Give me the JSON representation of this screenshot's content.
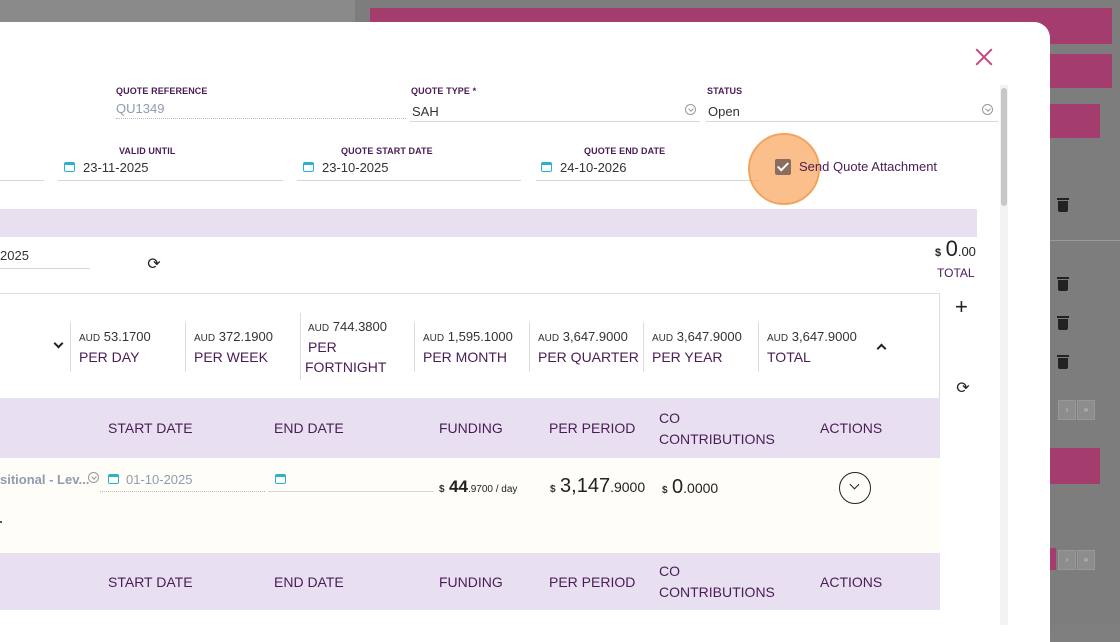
{
  "quote": {
    "reference": {
      "label": "QUOTE REFERENCE",
      "value": "QU1349"
    },
    "type": {
      "label": "QUOTE TYPE *",
      "value": "SAH"
    },
    "status": {
      "label": "STATUS",
      "value": "Open"
    },
    "valid_until": {
      "label": "VALID UNTIL",
      "value": "23-11-2025"
    },
    "start_date": {
      "label": "QUOTE START DATE",
      "value": "23-10-2025"
    },
    "end_date": {
      "label": "QUOTE END DATE",
      "value": "24-10-2026"
    },
    "send_attachment": {
      "label": "Send Quote Attachment",
      "checked": true
    },
    "date_partial": "2025",
    "total": {
      "currency": "$",
      "int": "0",
      "dec": ".00",
      "label": "TOTAL"
    }
  },
  "summary": [
    {
      "cur": "AUD",
      "int": "53",
      "dec": ".1700",
      "label": "PER DAY"
    },
    {
      "cur": "AUD",
      "int": "372",
      "dec": ".1900",
      "label": "PER WEEK"
    },
    {
      "cur": "AUD",
      "int": "744",
      "dec": ".3800",
      "label": "PER",
      "label2": "FORTNIGHT"
    },
    {
      "cur": "AUD",
      "int": "1,595",
      "dec": ".1000",
      "label": "PER MONTH"
    },
    {
      "cur": "AUD",
      "int": "3,647",
      "dec": ".9000",
      "label": "PER QUARTER"
    },
    {
      "cur": "AUD",
      "int": "3,647",
      "dec": ".9000",
      "label": "PER YEAR"
    },
    {
      "cur": "AUD",
      "int": "3,647",
      "dec": ".9000",
      "label": "TOTAL"
    }
  ],
  "table": {
    "headers": {
      "start": "START DATE",
      "end": "END DATE",
      "funding": "FUNDING",
      "per_period": "PER PERIOD",
      "co1": "CO",
      "co2": "CONTRIBUTIONS",
      "actions": "ACTIONS"
    },
    "row": {
      "service": "sitional - Lev...",
      "start_date": "01-10-2025",
      "funding": {
        "cur": "$",
        "int": "44",
        "dec": ".9700",
        "unit": " / day"
      },
      "per_period": {
        "cur": "$",
        "int": "3,147",
        "dec": ".9000"
      },
      "co": {
        "cur": "$",
        "int": "0",
        "dec": ".0000"
      }
    }
  },
  "icons": {
    "plus": "+",
    "refresh": "⟳"
  },
  "background": {
    "pager_next": "›",
    "pager_last": "»"
  },
  "colors": {
    "accent": "#c2477e",
    "label": "#4a1c56",
    "band": "#e8e0f1",
    "calendar": "#2ab3c6"
  }
}
